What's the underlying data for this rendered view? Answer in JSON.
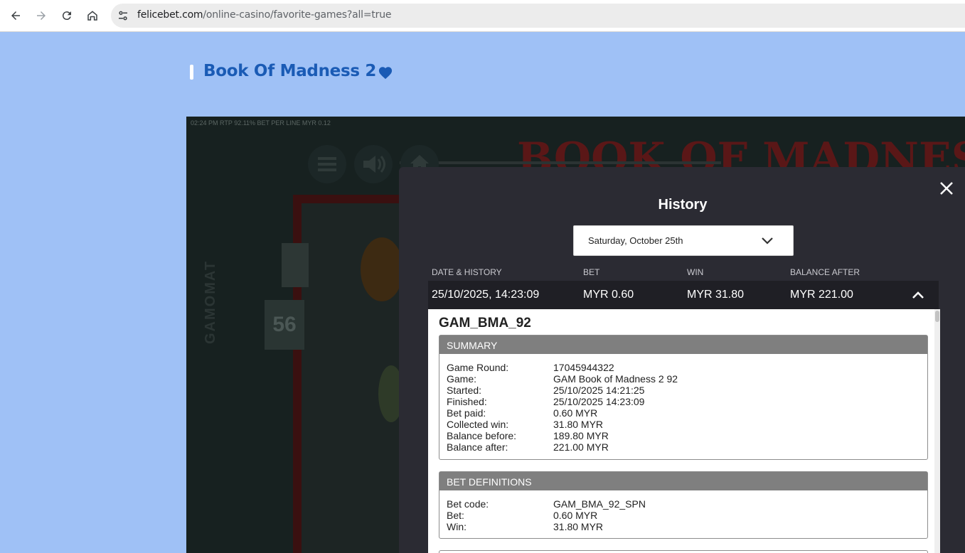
{
  "browser": {
    "url_host": "felicebet.com",
    "url_path": "/online-casino/favorite-games?all=true"
  },
  "page": {
    "game_title": "Book Of Madness 2"
  },
  "game": {
    "meta_line": "02:24 PM  RTP 92.11%  BET PER LINE MYR 0.12",
    "logo_text": "BOOK OF MADNESS II",
    "door_number": "56",
    "side_brand": "GAMOMAT"
  },
  "history": {
    "title": "History",
    "date_selected": "Saturday, October 25th",
    "columns": [
      "DATE & HISTORY",
      "BET",
      "WIN",
      "BALANCE AFTER"
    ],
    "row": {
      "datetime": "25/10/2025, 14:23:09",
      "bet": "MYR 0.60",
      "win": "MYR 31.80",
      "balance_after": "MYR 221.00"
    },
    "detail": {
      "code": "GAM_BMA_92",
      "summary_title": "SUMMARY",
      "summary": [
        {
          "k": "Game Round:",
          "v": "17045944322"
        },
        {
          "k": "Game:",
          "v": "GAM Book of Madness 2 92"
        },
        {
          "k": "Started:",
          "v": "25/10/2025 14:21:25"
        },
        {
          "k": "Finished:",
          "v": "25/10/2025 14:23:09"
        },
        {
          "k": "Bet paid:",
          "v": "0.60 MYR"
        },
        {
          "k": "Collected win:",
          "v": "31.80 MYR"
        },
        {
          "k": "Balance before:",
          "v": "189.80 MYR"
        },
        {
          "k": "Balance after:",
          "v": "221.00 MYR"
        }
      ],
      "bet_def_title": "BET DEFINITIONS",
      "bet_definitions": [
        {
          "k": "Bet code:",
          "v": "GAM_BMA_92_SPN"
        },
        {
          "k": "Bet:",
          "v": "0.60 MYR"
        },
        {
          "k": "Win:",
          "v": "31.80 MYR"
        }
      ]
    }
  },
  "colors": {
    "page_bg": "#9fc1f6",
    "title_blue": "#1a5bb5",
    "modal_bg": "#2b2b33",
    "section_head": "#7f7f7f"
  }
}
